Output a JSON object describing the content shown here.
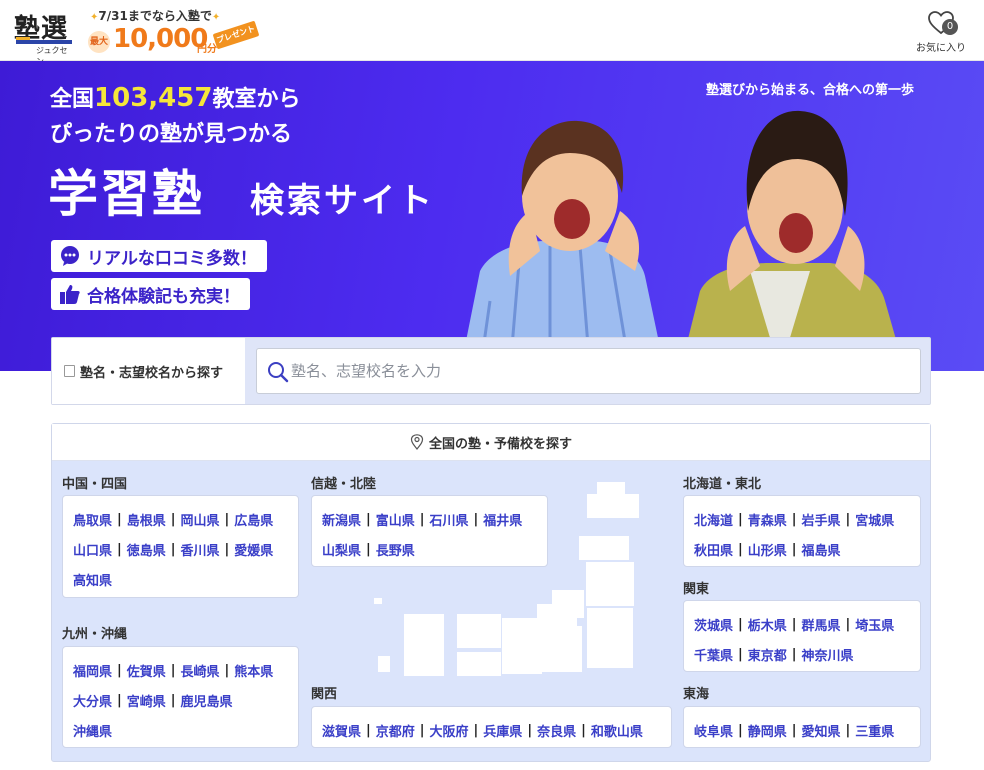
{
  "header": {
    "logo_text": "塾選",
    "logo_sub": "ジュクセン",
    "promo_text": "7/31までなら入塾で",
    "promo_max": "最大",
    "promo_amount": "10,000",
    "promo_unit": "円分",
    "promo_ribbon": "プレゼント",
    "favorites_label": "お気に入り",
    "favorites_count": "0"
  },
  "hero": {
    "line1_prefix": "全国",
    "line1_count": "103,457",
    "line1_suffix": "教室から",
    "line2": "ぴったりの塾が見つかる",
    "title_main": "学習塾",
    "title_sub": "検索サイト",
    "badge_reviews": "リアルな口コミ多数！",
    "badge_stories": "合格体験記も充実！",
    "tagline": "塾選びから始まる、合格への第一歩"
  },
  "search": {
    "tab_label": "塾名・志望校名から探す",
    "placeholder": "塾名、志望校名を入力"
  },
  "regions": {
    "heading": "全国の塾・予備校を探す",
    "groups": [
      {
        "name": "中国・四国",
        "rows": [
          [
            "鳥取県",
            "島根県",
            "岡山県",
            "広島県"
          ],
          [
            "山口県",
            "徳島県",
            "香川県",
            "愛媛県"
          ],
          [
            "高知県"
          ]
        ]
      },
      {
        "name": "九州・沖縄",
        "rows": [
          [
            "福岡県",
            "佐賀県",
            "長崎県",
            "熊本県"
          ],
          [
            "大分県",
            "宮崎県",
            "鹿児島県"
          ],
          [
            "沖縄県"
          ]
        ]
      },
      {
        "name": "信越・北陸",
        "rows": [
          [
            "新潟県",
            "富山県",
            "石川県",
            "福井県"
          ],
          [
            "山梨県",
            "長野県"
          ]
        ]
      },
      {
        "name": "関西",
        "rows": [
          [
            "滋賀県",
            "京都府",
            "大阪府",
            "兵庫県",
            "奈良県",
            "和歌山県"
          ]
        ]
      },
      {
        "name": "北海道・東北",
        "rows": [
          [
            "北海道",
            "青森県",
            "岩手県",
            "宮城県"
          ],
          [
            "秋田県",
            "山形県",
            "福島県"
          ]
        ]
      },
      {
        "name": "関東",
        "rows": [
          [
            "茨城県",
            "栃木県",
            "群馬県",
            "埼玉県"
          ],
          [
            "千葉県",
            "東京都",
            "神奈川県"
          ]
        ]
      },
      {
        "name": "東海",
        "rows": [
          [
            "岐阜県",
            "静岡県",
            "愛知県",
            "三重県"
          ]
        ]
      }
    ]
  },
  "colors": {
    "hero_bg": "#4d2cf0",
    "accent_yellow": "#f5e63a",
    "link_blue": "#3a3fc8",
    "panel_bg": "#dbe4fb",
    "promo_orange": "#f07a1a"
  }
}
